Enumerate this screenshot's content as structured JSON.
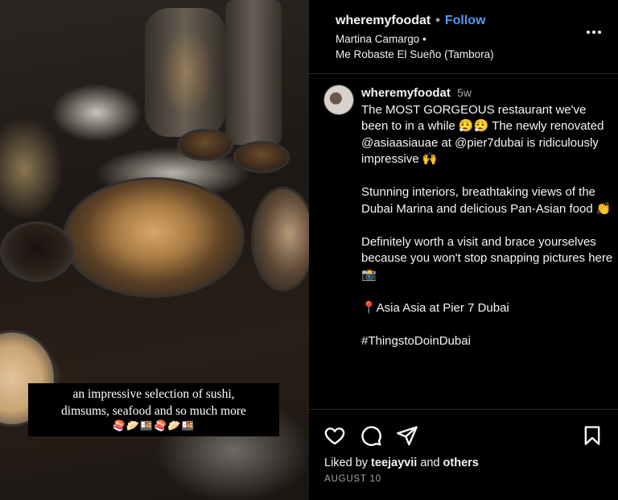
{
  "media": {
    "caption_line1": "an impressive selection of sushi,",
    "caption_line2": "dimsums, seafood and so much more",
    "caption_emoji": "🍣🥟🍱🍣🥟🍱"
  },
  "header": {
    "username": "wheremyfoodat",
    "separator": "•",
    "follow_label": "Follow",
    "tagged_user": "Martina Camargo •",
    "location": "Me Robaste El Sueño (Tambora)"
  },
  "caption": {
    "username": "wheremyfoodat",
    "time": "5w",
    "p1": "The MOST GORGEOUS restaurant we've been to in a while 😮‍💨😮‍💨 The newly renovated @asiaasiauae at @pier7dubai is ridiculously impressive 🙌",
    "p2": "Stunning interiors, breathtaking views of the Dubai Marina and delicious Pan-Asian food 👏",
    "p3": "Definitely worth a visit and brace yourselves because you won't stop snapping pictures here 📸",
    "p4": "📍Asia Asia at Pier 7 Dubai",
    "p5": "#ThingstoDoinDubai"
  },
  "footer": {
    "liked_by_prefix": "Liked by ",
    "liked_by_user": "teejayvii",
    "liked_by_and": " and ",
    "liked_by_others": "others",
    "date": "AUGUST 10"
  },
  "icons": {
    "like": "heart-icon",
    "comment": "comment-icon",
    "share": "send-icon",
    "save": "bookmark-icon",
    "more": "more-options-icon"
  },
  "colors": {
    "background": "#000000",
    "follow": "#4a9cf0",
    "secondary_text": "#a8a8a8",
    "divider": "#262626"
  }
}
